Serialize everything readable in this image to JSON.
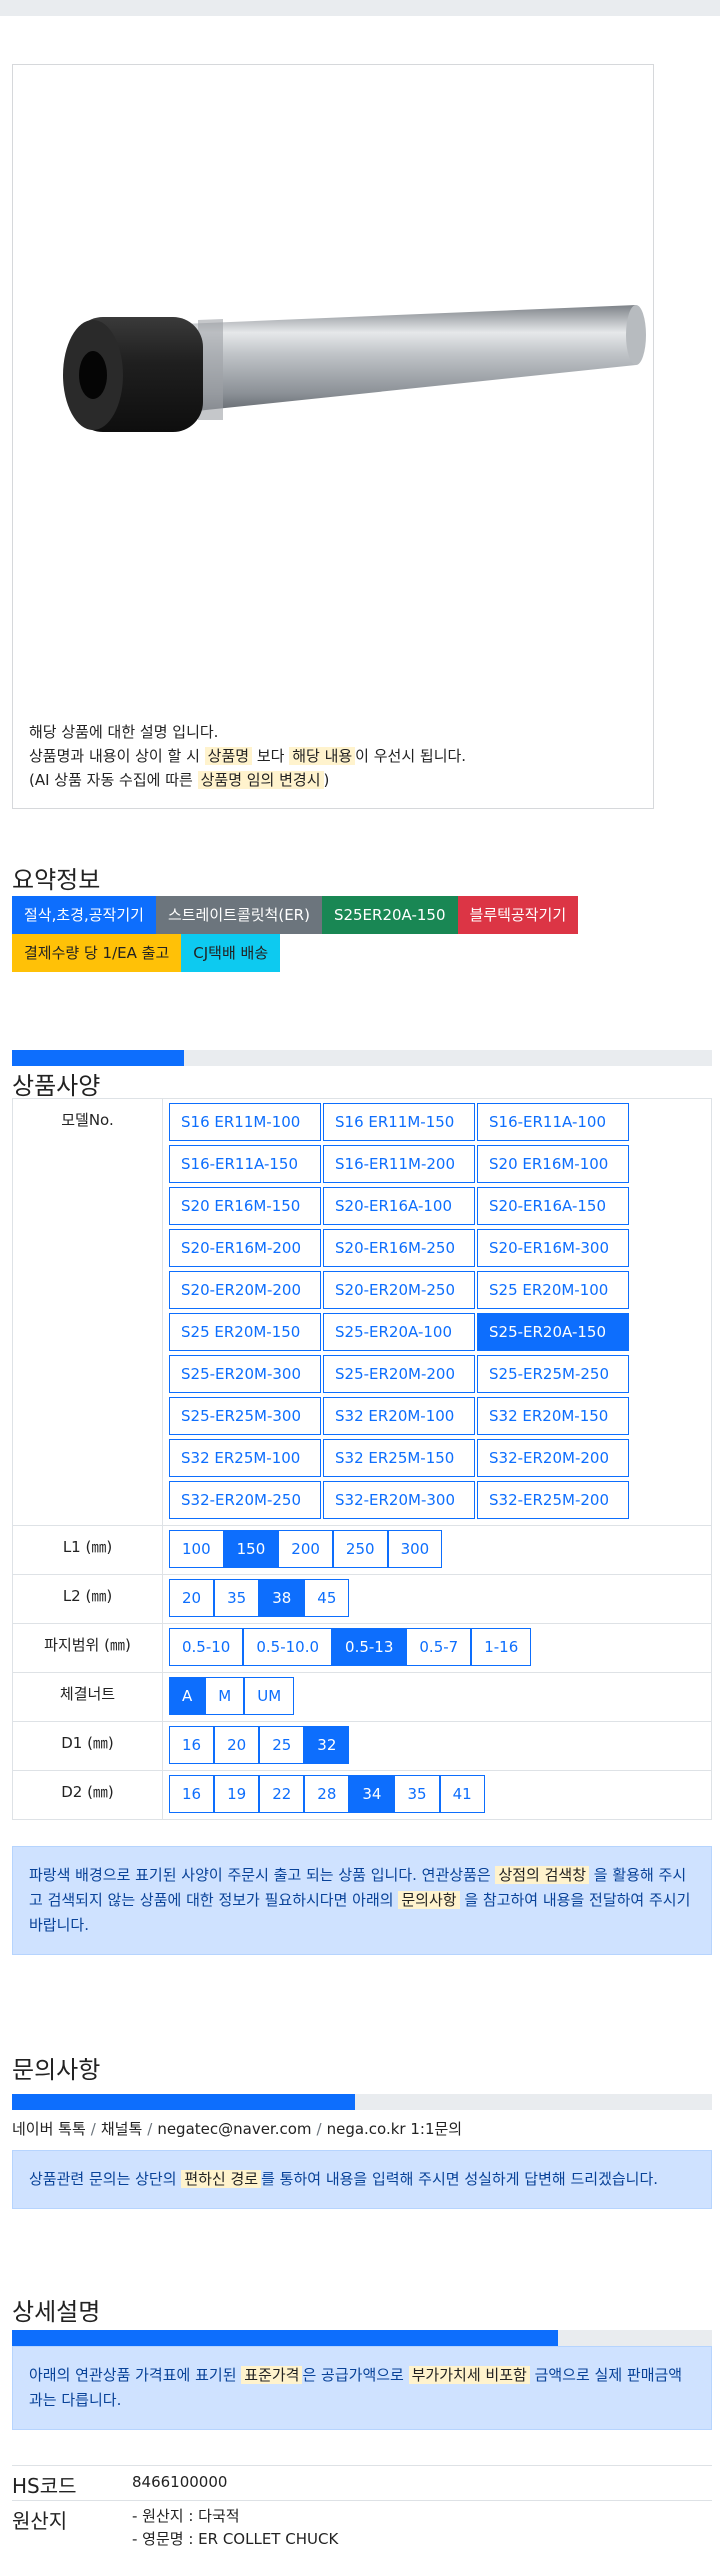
{
  "product": {
    "image_icon": "er-collet-chuck-straight-shank-image",
    "description": {
      "line1": "해당 상품에 대한 설명 입니다.",
      "line2_a": "상품명과 내용이 상이 할 시 ",
      "line2_hl1": "상품명",
      "line2_b": " 보다 ",
      "line2_hl2": "해당 내용",
      "line2_c": "이 우선시 됩니다.",
      "line3_a": "(AI 상품 자동 수집에 따른 ",
      "line3_hl": "상품명 임의 변경시",
      "line3_b": ")"
    }
  },
  "summary": {
    "title": "요약정보",
    "tags": [
      {
        "label": "절삭,초경,공작기기",
        "color": "blue"
      },
      {
        "label": "스트레이트콜릿척(ER)",
        "color": "gray"
      },
      {
        "label": "S25ER20A-150",
        "color": "green"
      },
      {
        "label": "블루텍공작기기",
        "color": "red"
      },
      {
        "label": "결제수량 당 1/EA 출고",
        "color": "yellow"
      },
      {
        "label": "CJ택배 배송",
        "color": "cyan"
      }
    ]
  },
  "specs": {
    "title": "상품사양",
    "progress_fraction": 0.245,
    "model_label": "모델No.",
    "models": [
      "S16 ER11M-100",
      "S16 ER11M-150",
      "S16-ER11A-100",
      "S16-ER11A-150",
      "S16-ER11M-200",
      "S20 ER16M-100",
      "S20 ER16M-150",
      "S20-ER16A-100",
      "S20-ER16A-150",
      "S20-ER16M-200",
      "S20-ER16M-250",
      "S20-ER16M-300",
      "S20-ER20M-200",
      "S20-ER20M-250",
      "S25 ER20M-100",
      "S25 ER20M-150",
      "S25-ER20A-100",
      "S25-ER20A-150",
      "S25-ER20M-300",
      "S25-ER20M-200",
      "S25-ER25M-250",
      "S25-ER25M-300",
      "S32 ER20M-100",
      "S32 ER20M-150",
      "S32 ER25M-100",
      "S32 ER25M-150",
      "S32-ER20M-200",
      "S32-ER20M-250",
      "S32-ER20M-300",
      "S32-ER25M-200"
    ],
    "model_selected": "S25-ER20A-150",
    "rows": [
      {
        "label": "L1 (㎜)",
        "options": [
          "100",
          "150",
          "200",
          "250",
          "300"
        ],
        "selected": "150"
      },
      {
        "label": "L2 (㎜)",
        "options": [
          "20",
          "35",
          "38",
          "45"
        ],
        "selected": "38"
      },
      {
        "label": "파지범위 (㎜)",
        "options": [
          "0.5-10",
          "0.5-10.0",
          "0.5-13",
          "0.5-7",
          "1-16"
        ],
        "selected": "0.5-13"
      },
      {
        "label": "체결너트",
        "options": [
          "A",
          "M",
          "UM"
        ],
        "selected": "A"
      },
      {
        "label": "D1 (㎜)",
        "options": [
          "16",
          "20",
          "25",
          "32"
        ],
        "selected": "32"
      },
      {
        "label": "D2 (㎜)",
        "options": [
          "16",
          "19",
          "22",
          "28",
          "34",
          "35",
          "41"
        ],
        "selected": "34"
      }
    ],
    "notice": {
      "a": "파랑색 배경으로 표기된 사양이 주문시 출고 되는 상품 입니다. 연관상품은 ",
      "hl1": "상점의 검색창",
      "b": " 을 활용해 주시고 검색되지 않는 상품에 대한 정보가 필요하시다면 아래의 ",
      "hl2": "문의사항",
      "c": " 을 참고하여 내용을 전달하여 주시기 바랍니다."
    }
  },
  "inquiry": {
    "title": "문의사항",
    "progress_fraction": 0.49,
    "links": [
      "네이버 톡톡",
      "채널톡",
      "negatec@naver.com",
      "nega.co.kr 1:1문의"
    ],
    "notice": {
      "a": "상품관련 문의는 상단의 ",
      "hl": "편하신 경로",
      "b": "를 통하여 내용을 입력해 주시면 성실하게 답변해 드리겠습니다."
    }
  },
  "detail": {
    "title": "상세설명",
    "progress_fraction": 0.78,
    "notice": {
      "a": "아래의 연관상품 가격표에 표기된 ",
      "hl1": "표준가격",
      "b": "은 공급가액으로 ",
      "hl2": "부가가치세 비포함",
      "c": " 금액으로 실제 판매금액과는 다릅니다."
    },
    "hs_label": "HS코드",
    "hs_value": "8466100000",
    "origin_label": "원산지",
    "origin_line1": "- 원산지 : 다국적",
    "origin_line2": "- 영문명 : ER COLLET CHUCK"
  }
}
